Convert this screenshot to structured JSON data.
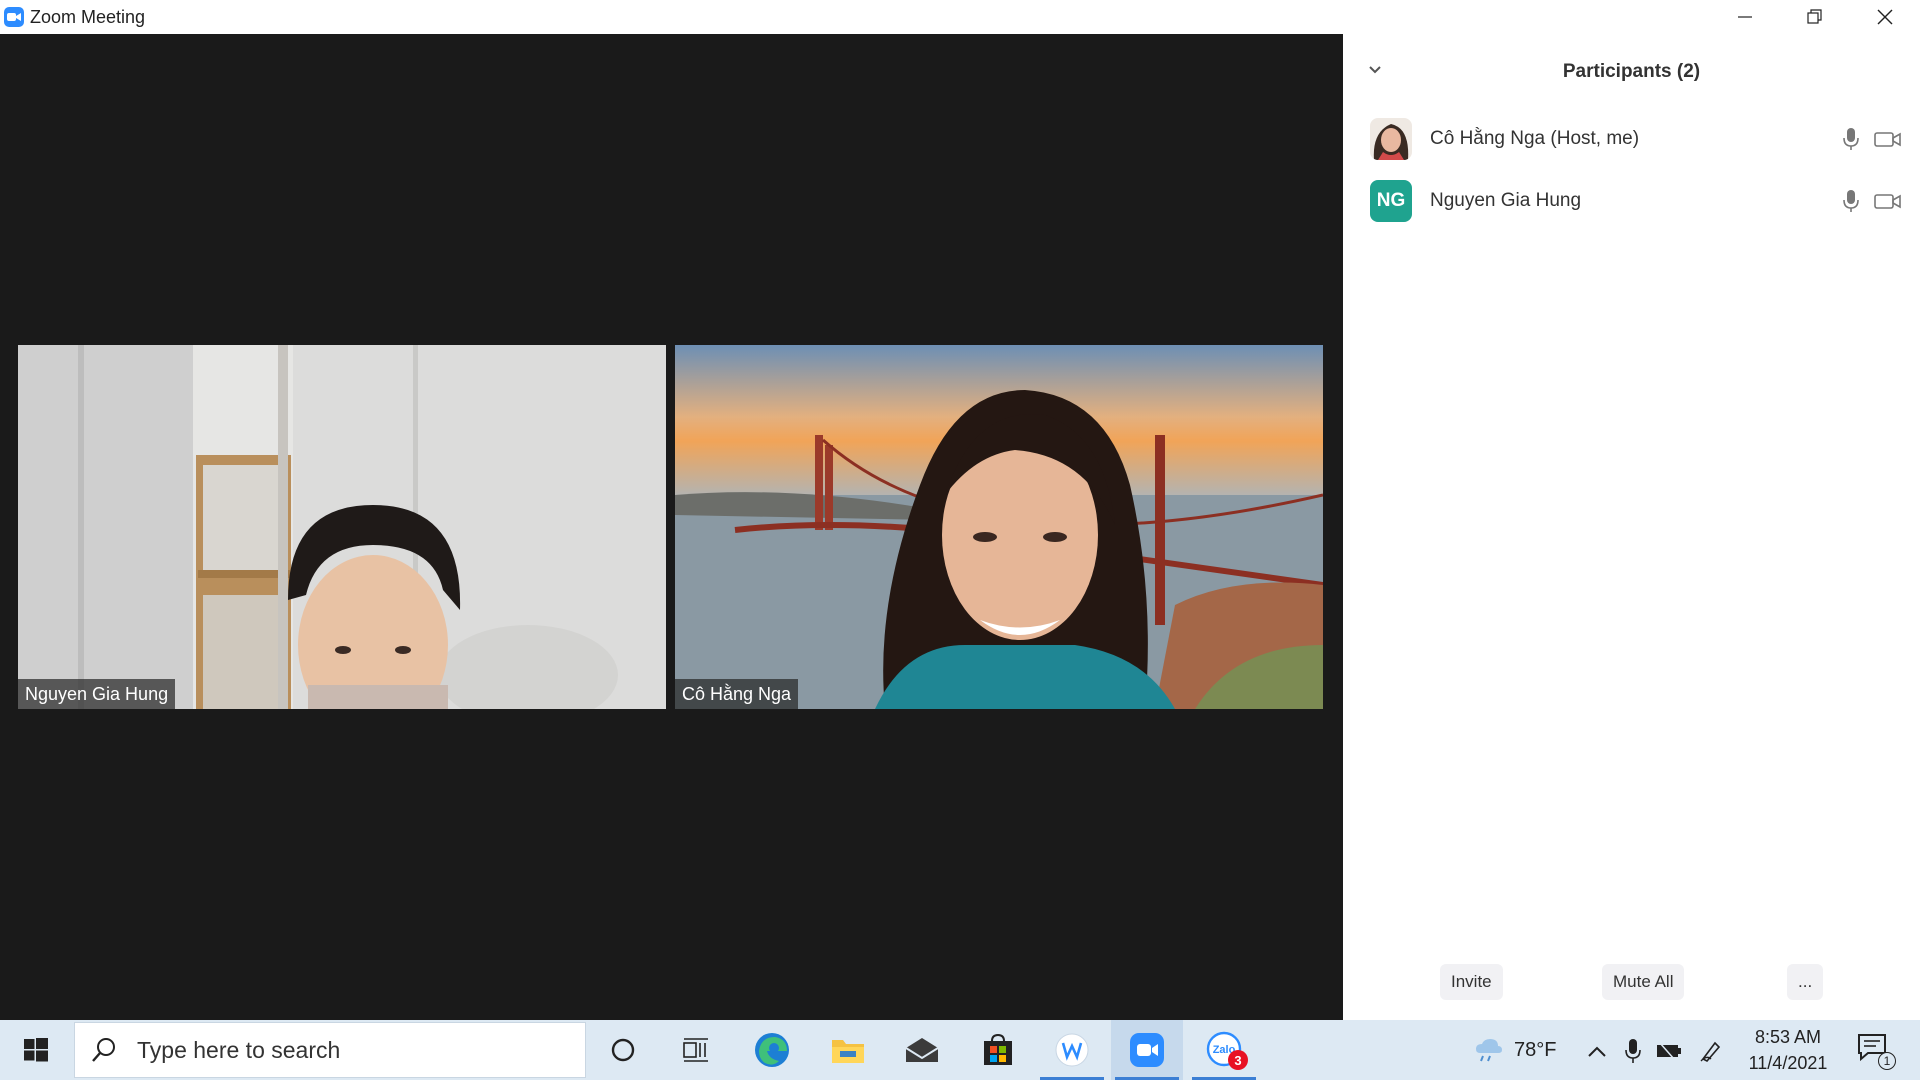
{
  "window": {
    "title": "Zoom Meeting",
    "app_icon": "zoom-camera-icon"
  },
  "video_tiles": [
    {
      "name": "Nguyen Gia Hung"
    },
    {
      "name": "Cô Hằng Nga"
    }
  ],
  "participants_panel": {
    "title": "Participants (2)",
    "participants": [
      {
        "name": "Cô Hằng Nga (Host, me)",
        "avatar": "photo",
        "mic_icon": "mic-icon",
        "video_icon": "video-camera-icon"
      },
      {
        "name": "Nguyen Gia Hung",
        "initials": "NG",
        "avatar_color": "#1fa38f",
        "mic_icon": "mic-icon",
        "video_icon": "video-camera-icon"
      }
    ],
    "buttons": {
      "invite": "Invite",
      "mute_all": "Mute All",
      "more": "..."
    }
  },
  "taskbar": {
    "search_placeholder": "Type here to search",
    "zalo_badge": "3",
    "weather_temp": "78°F",
    "time": "8:53 AM",
    "date": "11/4/2021",
    "notification_count": "1"
  },
  "colors": {
    "video_bg": "#1a1a1a",
    "zoom_blue": "#2d8cff",
    "taskbar_bg": "#dde9f3"
  }
}
